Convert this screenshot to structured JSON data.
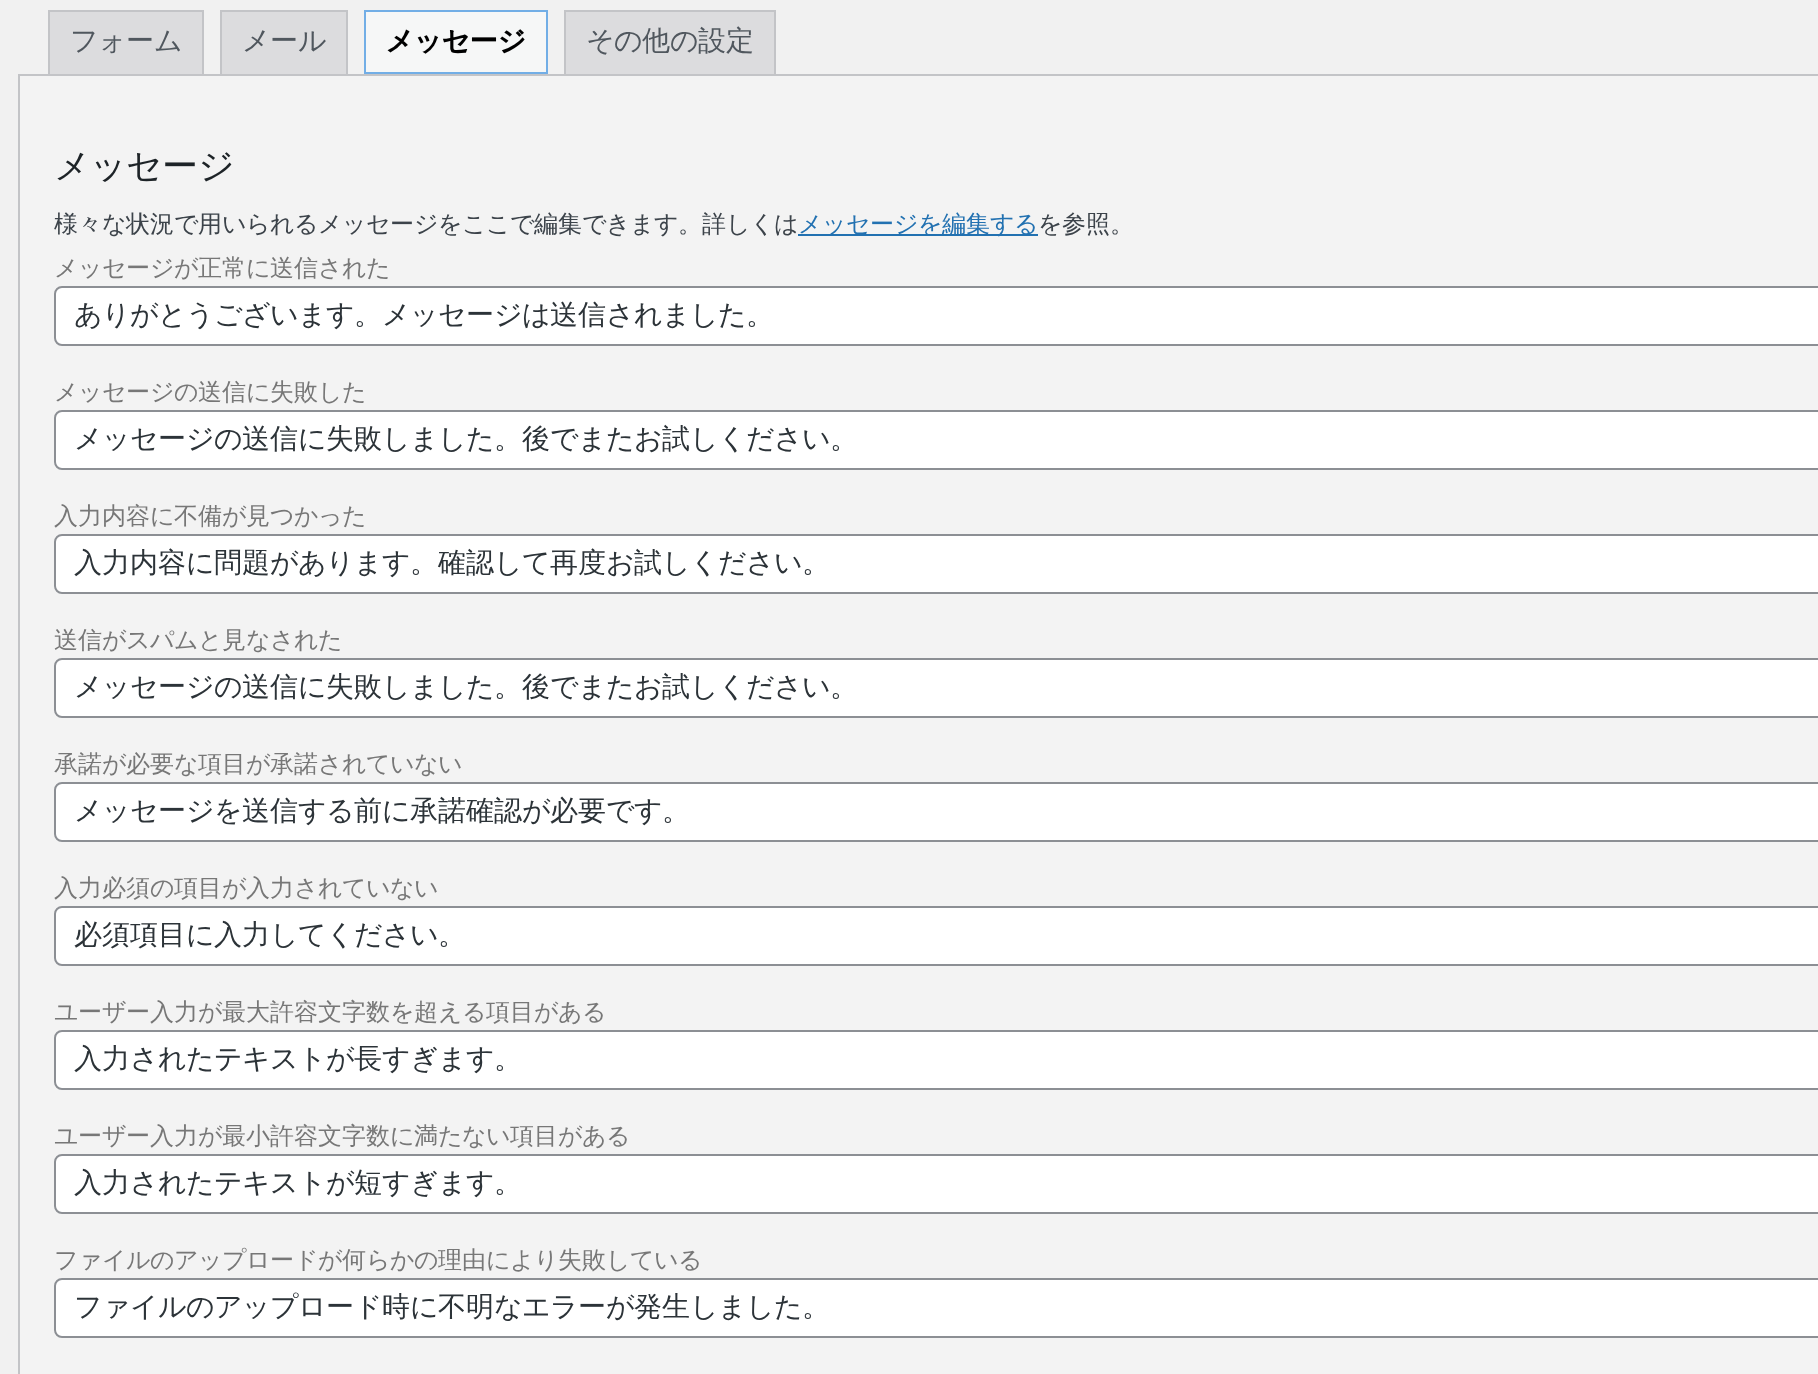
{
  "tabs": [
    {
      "label": "フォーム",
      "selected": false
    },
    {
      "label": "メール",
      "selected": false
    },
    {
      "label": "メッセージ",
      "selected": true
    },
    {
      "label": "その他の設定",
      "selected": false
    }
  ],
  "section": {
    "title": "メッセージ",
    "description": {
      "before": "様々な状況で用いられるメッセージをここで編集できます。詳しくは",
      "link": "メッセージを編集する",
      "after": "を参照。"
    }
  },
  "fields": [
    {
      "label": "メッセージが正常に送信された",
      "value": "ありがとうございます。メッセージは送信されました。"
    },
    {
      "label": "メッセージの送信に失敗した",
      "value": "メッセージの送信に失敗しました。後でまたお試しください。"
    },
    {
      "label": "入力内容に不備が見つかった",
      "value": "入力内容に問題があります。確認して再度お試しください。"
    },
    {
      "label": "送信がスパムと見なされた",
      "value": "メッセージの送信に失敗しました。後でまたお試しください。"
    },
    {
      "label": "承諾が必要な項目が承諾されていない",
      "value": "メッセージを送信する前に承諾確認が必要です。"
    },
    {
      "label": "入力必須の項目が入力されていない",
      "value": "必須項目に入力してください。"
    },
    {
      "label": "ユーザー入力が最大許容文字数を超える項目がある",
      "value": "入力されたテキストが長すぎます。"
    },
    {
      "label": "ユーザー入力が最小許容文字数に満たない項目がある",
      "value": "入力されたテキストが短すぎます。"
    },
    {
      "label": "ファイルのアップロードが何らかの理由により失敗している",
      "value": "ファイルのアップロード時に不明なエラーが発生しました。"
    }
  ]
}
